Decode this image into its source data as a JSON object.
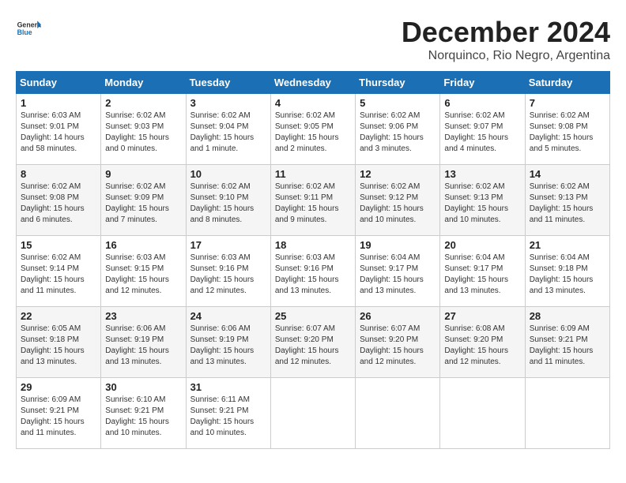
{
  "logo": {
    "text_general": "General",
    "text_blue": "Blue"
  },
  "title": "December 2024",
  "location": "Norquinco, Rio Negro, Argentina",
  "days_of_week": [
    "Sunday",
    "Monday",
    "Tuesday",
    "Wednesday",
    "Thursday",
    "Friday",
    "Saturday"
  ],
  "weeks": [
    [
      {
        "day": 1,
        "info": "Sunrise: 6:03 AM\nSunset: 9:01 PM\nDaylight: 14 hours\nand 58 minutes."
      },
      {
        "day": 2,
        "info": "Sunrise: 6:02 AM\nSunset: 9:03 PM\nDaylight: 15 hours\nand 0 minutes."
      },
      {
        "day": 3,
        "info": "Sunrise: 6:02 AM\nSunset: 9:04 PM\nDaylight: 15 hours\nand 1 minute."
      },
      {
        "day": 4,
        "info": "Sunrise: 6:02 AM\nSunset: 9:05 PM\nDaylight: 15 hours\nand 2 minutes."
      },
      {
        "day": 5,
        "info": "Sunrise: 6:02 AM\nSunset: 9:06 PM\nDaylight: 15 hours\nand 3 minutes."
      },
      {
        "day": 6,
        "info": "Sunrise: 6:02 AM\nSunset: 9:07 PM\nDaylight: 15 hours\nand 4 minutes."
      },
      {
        "day": 7,
        "info": "Sunrise: 6:02 AM\nSunset: 9:08 PM\nDaylight: 15 hours\nand 5 minutes."
      }
    ],
    [
      {
        "day": 8,
        "info": "Sunrise: 6:02 AM\nSunset: 9:08 PM\nDaylight: 15 hours\nand 6 minutes."
      },
      {
        "day": 9,
        "info": "Sunrise: 6:02 AM\nSunset: 9:09 PM\nDaylight: 15 hours\nand 7 minutes."
      },
      {
        "day": 10,
        "info": "Sunrise: 6:02 AM\nSunset: 9:10 PM\nDaylight: 15 hours\nand 8 minutes."
      },
      {
        "day": 11,
        "info": "Sunrise: 6:02 AM\nSunset: 9:11 PM\nDaylight: 15 hours\nand 9 minutes."
      },
      {
        "day": 12,
        "info": "Sunrise: 6:02 AM\nSunset: 9:12 PM\nDaylight: 15 hours\nand 10 minutes."
      },
      {
        "day": 13,
        "info": "Sunrise: 6:02 AM\nSunset: 9:13 PM\nDaylight: 15 hours\nand 10 minutes."
      },
      {
        "day": 14,
        "info": "Sunrise: 6:02 AM\nSunset: 9:13 PM\nDaylight: 15 hours\nand 11 minutes."
      }
    ],
    [
      {
        "day": 15,
        "info": "Sunrise: 6:02 AM\nSunset: 9:14 PM\nDaylight: 15 hours\nand 11 minutes."
      },
      {
        "day": 16,
        "info": "Sunrise: 6:03 AM\nSunset: 9:15 PM\nDaylight: 15 hours\nand 12 minutes."
      },
      {
        "day": 17,
        "info": "Sunrise: 6:03 AM\nSunset: 9:16 PM\nDaylight: 15 hours\nand 12 minutes."
      },
      {
        "day": 18,
        "info": "Sunrise: 6:03 AM\nSunset: 9:16 PM\nDaylight: 15 hours\nand 13 minutes."
      },
      {
        "day": 19,
        "info": "Sunrise: 6:04 AM\nSunset: 9:17 PM\nDaylight: 15 hours\nand 13 minutes."
      },
      {
        "day": 20,
        "info": "Sunrise: 6:04 AM\nSunset: 9:17 PM\nDaylight: 15 hours\nand 13 minutes."
      },
      {
        "day": 21,
        "info": "Sunrise: 6:04 AM\nSunset: 9:18 PM\nDaylight: 15 hours\nand 13 minutes."
      }
    ],
    [
      {
        "day": 22,
        "info": "Sunrise: 6:05 AM\nSunset: 9:18 PM\nDaylight: 15 hours\nand 13 minutes."
      },
      {
        "day": 23,
        "info": "Sunrise: 6:06 AM\nSunset: 9:19 PM\nDaylight: 15 hours\nand 13 minutes."
      },
      {
        "day": 24,
        "info": "Sunrise: 6:06 AM\nSunset: 9:19 PM\nDaylight: 15 hours\nand 13 minutes."
      },
      {
        "day": 25,
        "info": "Sunrise: 6:07 AM\nSunset: 9:20 PM\nDaylight: 15 hours\nand 12 minutes."
      },
      {
        "day": 26,
        "info": "Sunrise: 6:07 AM\nSunset: 9:20 PM\nDaylight: 15 hours\nand 12 minutes."
      },
      {
        "day": 27,
        "info": "Sunrise: 6:08 AM\nSunset: 9:20 PM\nDaylight: 15 hours\nand 12 minutes."
      },
      {
        "day": 28,
        "info": "Sunrise: 6:09 AM\nSunset: 9:21 PM\nDaylight: 15 hours\nand 11 minutes."
      }
    ],
    [
      {
        "day": 29,
        "info": "Sunrise: 6:09 AM\nSunset: 9:21 PM\nDaylight: 15 hours\nand 11 minutes."
      },
      {
        "day": 30,
        "info": "Sunrise: 6:10 AM\nSunset: 9:21 PM\nDaylight: 15 hours\nand 10 minutes."
      },
      {
        "day": 31,
        "info": "Sunrise: 6:11 AM\nSunset: 9:21 PM\nDaylight: 15 hours\nand 10 minutes."
      },
      null,
      null,
      null,
      null
    ]
  ]
}
